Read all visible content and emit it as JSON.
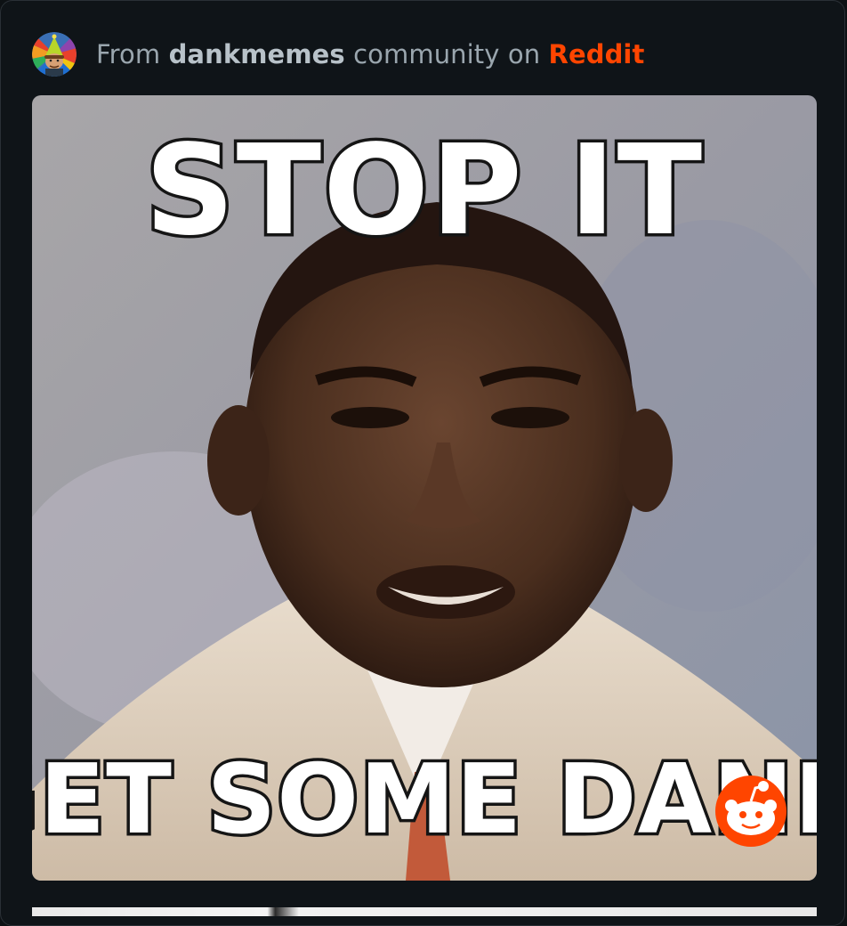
{
  "header": {
    "prefix": "From",
    "community": "dankmemes",
    "middle": "community on",
    "brand": "Reddit",
    "avatar_icon": "community-avatar-icon"
  },
  "meme": {
    "top_text": "STOP IT",
    "bottom_text": "GET SOME DANK",
    "watermark_icon": "reddit-snoo-icon"
  },
  "colors": {
    "brand": "#ff4500",
    "background": "#0d1114"
  }
}
